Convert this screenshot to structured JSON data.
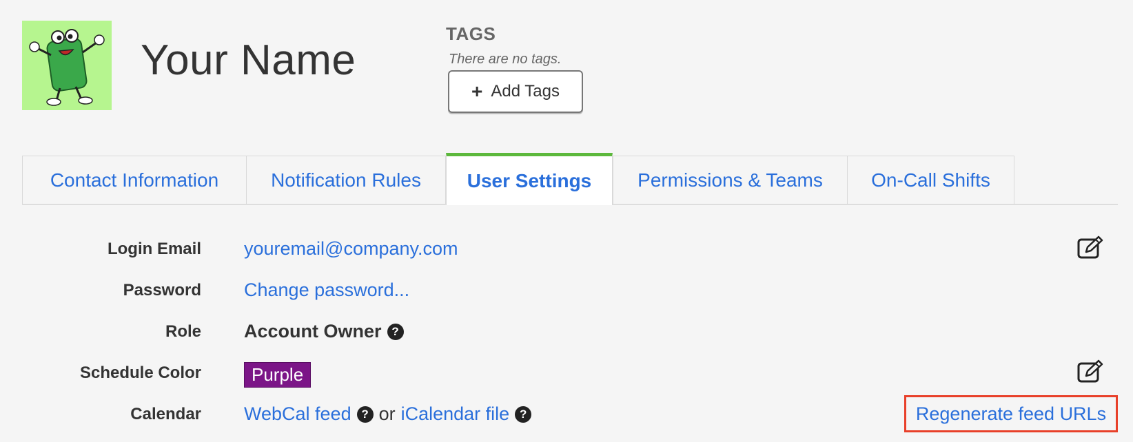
{
  "profile": {
    "name": "Your Name",
    "avatar_icon": "cartoon-mascot-icon"
  },
  "tags": {
    "title": "TAGS",
    "empty_text": "There are no tags.",
    "add_button_label": "Add Tags"
  },
  "tabs": [
    {
      "label": "Contact Information",
      "active": false
    },
    {
      "label": "Notification Rules",
      "active": false
    },
    {
      "label": "User Settings",
      "active": true
    },
    {
      "label": "Permissions & Teams",
      "active": false
    },
    {
      "label": "On-Call Shifts",
      "active": false
    }
  ],
  "settings": {
    "login_email": {
      "label": "Login Email",
      "value": "youremail@company.com"
    },
    "password": {
      "label": "Password",
      "value": "Change password..."
    },
    "role": {
      "label": "Role",
      "value": "Account Owner"
    },
    "schedule_color": {
      "label": "Schedule Color",
      "value": "Purple",
      "color": "#7b1587"
    },
    "calendar": {
      "label": "Calendar",
      "webcal": "WebCal feed",
      "separator": "or",
      "icalendar": "iCalendar file",
      "regenerate": "Regenerate feed URLs"
    }
  },
  "colors": {
    "link": "#2a6fdb",
    "active_tab_accent": "#5cb83c",
    "highlight_border": "#e8402a",
    "background": "#f5f5f5"
  }
}
